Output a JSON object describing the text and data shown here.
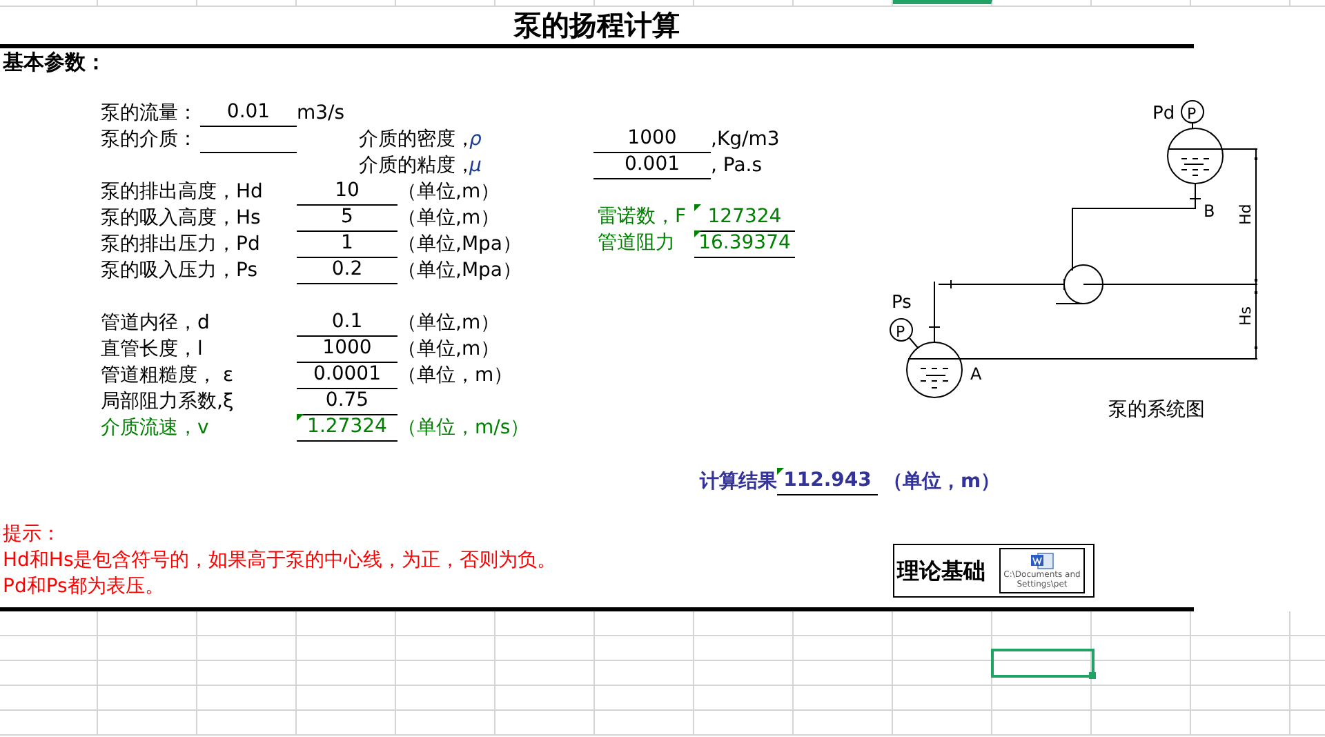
{
  "title": "泵的扬程计算",
  "section": "基本参数：",
  "flow": {
    "label": "泵的流量：",
    "value": "0.01",
    "unit": "m3/s"
  },
  "medium": {
    "label": "泵的介质："
  },
  "medium_props": [
    {
      "label": "介质的密度，",
      "symbol": "ρ",
      "value": "1000",
      "unit": ",Kg/m3"
    },
    {
      "label": "介质的粘度，",
      "symbol": "μ",
      "value": "0.001",
      "unit": ", Pa.s"
    }
  ],
  "pump_params": [
    {
      "label": "泵的排出高度，Hd",
      "value": "10",
      "unit": "（单位,m）"
    },
    {
      "label": "泵的吸入高度，Hs",
      "value": "5",
      "unit": "（单位,m）"
    },
    {
      "label": "泵的排出压力，Pd",
      "value": "1",
      "unit": "（单位,Mpa）"
    },
    {
      "label": "泵的吸入压力，Ps",
      "value": "0.2",
      "unit": "（单位,Mpa）"
    }
  ],
  "derived": [
    {
      "label": "雷诺数，F",
      "value": "127324"
    },
    {
      "label": "管道阻力",
      "value": "16.39374"
    }
  ],
  "pipe_params": [
    {
      "label": "管道内径，d",
      "value": "0.1",
      "unit": "（单位,m）",
      "computed": false
    },
    {
      "label": "直管长度，l",
      "value": "1000",
      "unit": "（单位,m）",
      "computed": false
    },
    {
      "label": "管道粗糙度， ε",
      "value": "0.0001",
      "unit": "（单位，m）",
      "computed": false
    },
    {
      "label": "局部阻力系数,ξ",
      "value": "0.75",
      "computed": false
    },
    {
      "label": "介质流速，v",
      "value": "1.27324",
      "unit": "（单位，m/s）",
      "computed": true
    }
  ],
  "diagram": {
    "discharge_pressure": "Pd",
    "suction_pressure": "Ps",
    "gauges": [
      "P",
      "P"
    ],
    "upper_tank": "B",
    "lower_tank": "A",
    "discharge_height": "Hd",
    "suction_height": "Hs",
    "caption": "泵的系统图"
  },
  "result": {
    "label": "计算结果",
    "value": "112.943",
    "unit": "（单位，m）"
  },
  "hint": {
    "title": "提示：",
    "lines": [
      "Hd和Hs是包含符号的，如果高于泵的中心线，为正，否则为负。",
      "Pd和Ps都为表压。"
    ]
  },
  "theory": {
    "label": "理论基础",
    "object_caption": "C:\\Documents and Settings\\pet"
  }
}
